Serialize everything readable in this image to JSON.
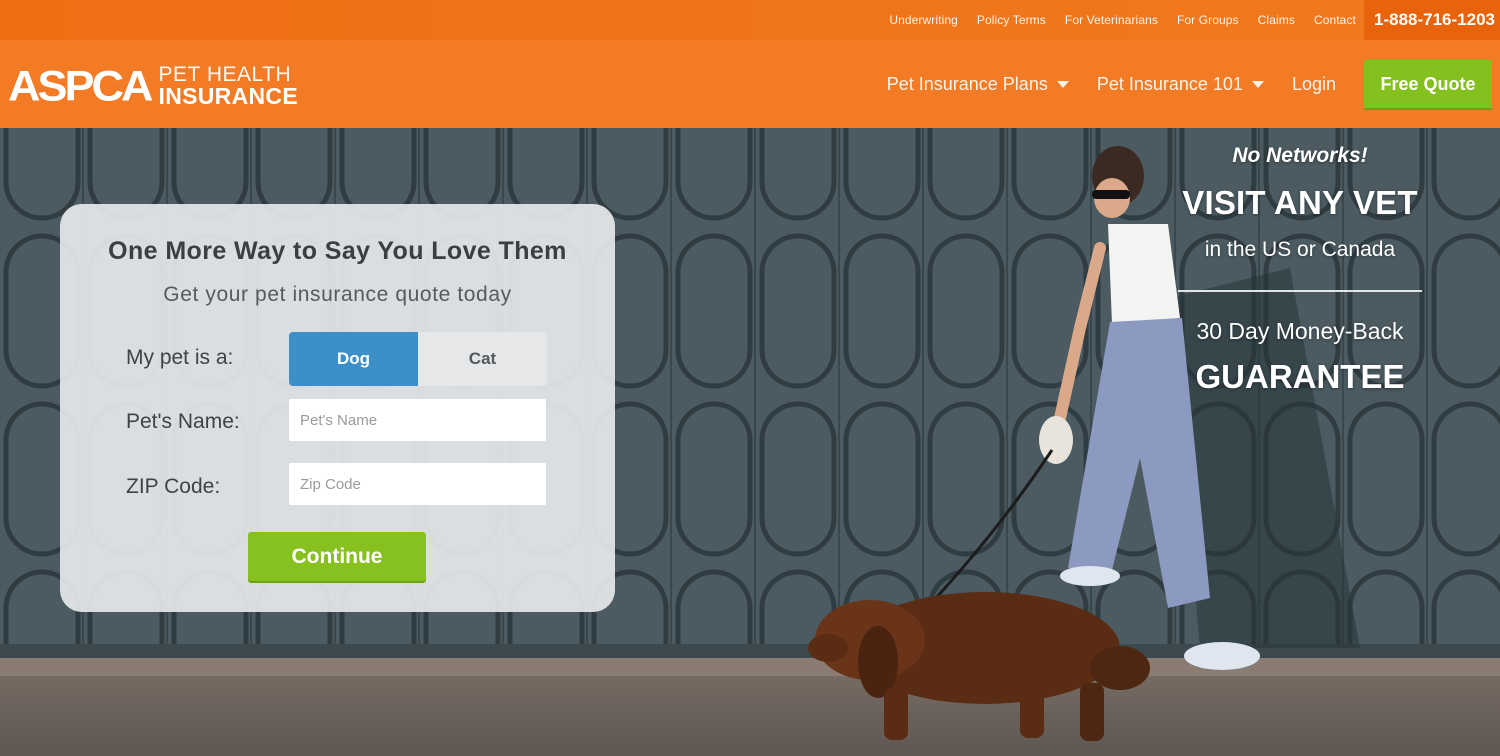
{
  "topbar": {
    "links": [
      "Underwriting",
      "Policy Terms",
      "For Veterinarians",
      "For Groups",
      "Claims",
      "Contact"
    ],
    "phone": "1-888-716-1203"
  },
  "header": {
    "logo": {
      "mark": "ASPCA",
      "line1": "PET HEALTH",
      "line2": "INSURANCE"
    },
    "nav": {
      "plans": "Pet Insurance Plans",
      "ins101": "Pet Insurance 101",
      "login": "Login"
    },
    "cta": "Free Quote"
  },
  "quote_form": {
    "title": "One More Way to Say You Love Them",
    "subtitle": "Get your pet insurance quote today",
    "pet_type_label": "My pet is a:",
    "pet_options": [
      "Dog",
      "Cat"
    ],
    "selected_pet": "Dog",
    "pet_name_label": "Pet's Name:",
    "pet_name_placeholder": "Pet's Name",
    "zip_label": "ZIP Code:",
    "zip_placeholder": "Zip Code",
    "continue_label": "Continue"
  },
  "promo": {
    "line1": "No Networks!",
    "line2": "VISIT ANY VET",
    "line3": "in the US or Canada",
    "line4": "30 Day Money-Back",
    "line5": "GUARANTEE"
  },
  "colors": {
    "topbar": "#f06d14",
    "header": "#f47b26",
    "green_cta": "#84c11e",
    "dog_selected": "#3d8fc8",
    "gate": "#4a5a60"
  }
}
